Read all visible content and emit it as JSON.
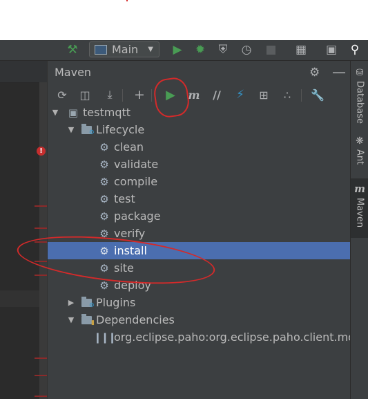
{
  "toolbar": {
    "build_icon": "hammer-icon",
    "run_config": "Main",
    "icons": [
      "run-icon",
      "debug-icon",
      "coverage-icon",
      "profile-icon",
      "stop-icon",
      "project-structure-icon",
      "terminal-icon",
      "search-icon"
    ]
  },
  "panel": {
    "title": "Maven",
    "header_icons": [
      "gear-icon",
      "minimize-icon"
    ],
    "toolbar_icons": [
      "reload-icon",
      "generate-sources-icon",
      "download-icon",
      "add-icon",
      "run-maven-build-icon",
      "execute-maven-goal-icon",
      "toggle-offline-icon",
      "skip-tests-icon",
      "show-dependencies-icon",
      "collapse-all-icon",
      "settings-wrench-icon"
    ]
  },
  "tree": {
    "project": "testmqtt",
    "lifecycle": {
      "label": "Lifecycle",
      "goals": [
        "clean",
        "validate",
        "compile",
        "test",
        "package",
        "verify",
        "install",
        "site",
        "deploy"
      ],
      "selected": "install"
    },
    "plugins": "Plugins",
    "dependencies": {
      "label": "Dependencies",
      "items": [
        "org.eclipse.paho:org.eclipse.paho.client.mqttv"
      ]
    }
  },
  "sidebar": {
    "tabs": [
      "Database",
      "Ant",
      "Maven"
    ],
    "active": "Maven"
  },
  "colors": {
    "accent": "#4b6eaf",
    "run_green": "#499c54",
    "annotation": "#d42a2a"
  }
}
